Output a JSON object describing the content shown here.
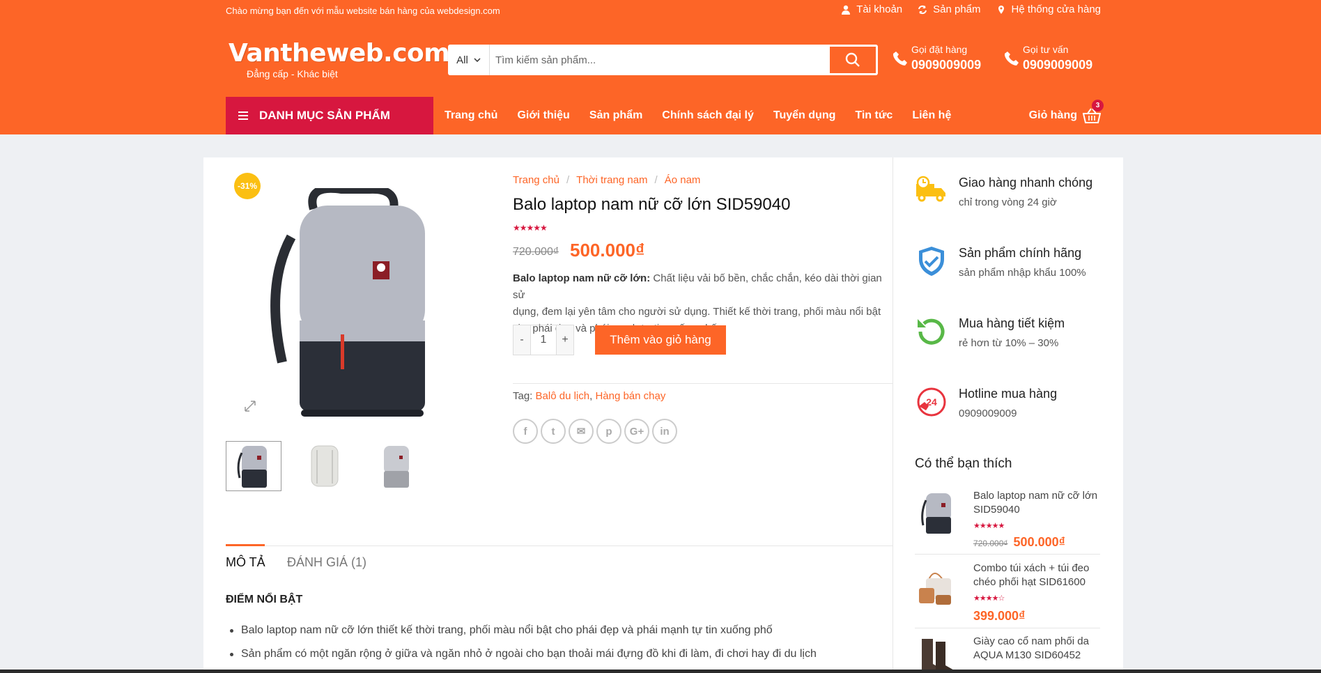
{
  "topbar": {
    "welcome": "Chào mừng bạn đến với mẫu website bán hàng của webdesign.com",
    "links": [
      "Tài khoản",
      "Sản phẩm",
      "Hệ thống cửa hàng"
    ]
  },
  "header": {
    "logo": "Vantheweb.com",
    "slogan": "Đẳng cấp - Khác biệt",
    "search_category": "All",
    "search_placeholder": "Tìm kiếm sản phẩm...",
    "hotline_order_label": "Gọi đặt hàng",
    "hotline_order_number": "0909009009",
    "hotline_advice_label": "Gọi tư vấn",
    "hotline_advice_number": "0909009009"
  },
  "nav": {
    "category_button": "DANH MỤC SẢN PHẨM",
    "links": [
      "Trang chủ",
      "Giới thiệu",
      "Sản phẩm",
      "Chính sách đại lý",
      "Tuyển dụng",
      "Tin tức",
      "Liên hệ"
    ],
    "cart_label": "Giỏ hàng",
    "cart_count": "3"
  },
  "product": {
    "sale_badge": "-31%",
    "breadcrumb": [
      "Trang chủ",
      "Thời trang nam",
      "Áo nam"
    ],
    "title": "Balo laptop nam nữ cỡ lớn SID59040",
    "rating_stars": "★★★★★",
    "old_price": "720.000₫",
    "new_price": "500.000₫",
    "desc_bold": "Balo laptop nam nữ cỡ lớn:",
    "desc_line1": " Chất liệu vải bố bền, chắc chắn, kéo dài thời gian sử",
    "desc_line2": "dụng, đem lại yên tâm cho người sử dụng. Thiết kế thời trang, phối màu nổi bật",
    "desc_line3": "cho phái đẹp và phái mạnh tự tin xuống phố",
    "qty_minus": "-",
    "qty_value": "1",
    "qty_plus": "+",
    "add_to_cart": "Thêm vào giỏ hàng",
    "tag_label": "Tag:",
    "tags": [
      "Balô du lịch",
      "Hàng bán chạy"
    ],
    "share_icons": [
      "f",
      "t",
      "✉",
      "p",
      "G+",
      "in"
    ]
  },
  "tabs": {
    "description": "MÔ TẢ",
    "reviews": "ĐÁNH GIÁ (1)"
  },
  "description": {
    "heading": "ĐIỂM NỔI BẬT",
    "bullets": [
      "Balo laptop nam nữ cỡ lớn thiết kế thời trang, phối màu nổi bật cho phái đẹp và phái mạnh tự tin xuống phố",
      "Sản phẩm có một ngăn rộng ở giữa và ngăn nhỏ ở ngoài cho bạn thoải mái đựng đồ khi đi làm, đi chơi hay đi du lịch"
    ]
  },
  "sidebar": {
    "features": [
      {
        "title": "Giao hàng nhanh chóng",
        "desc": "chỉ trong vòng 24 giờ",
        "icon": "truck-icon"
      },
      {
        "title": "Sản phẩm chính hãng",
        "desc": "sản phẩm nhập khẩu 100%",
        "icon": "shield-check-icon"
      },
      {
        "title": "Mua hàng tiết kiệm",
        "desc": "rẻ hơn từ 10% – 30%",
        "icon": "refresh-icon"
      },
      {
        "title": "Hotline mua hàng",
        "desc": "0909009009",
        "icon": "phone-24-icon"
      }
    ],
    "may_like_title": "Có thể bạn thích",
    "related": [
      {
        "name": "Balo laptop nam nữ cỡ lớn SID59040",
        "stars": "★★★★★",
        "old_price": "720.000₫",
        "price": "500.000₫"
      },
      {
        "name": "Combo túi xách + túi đeo chéo phối hạt SID61600",
        "stars": "★★★★☆",
        "old_price": "",
        "price": "399.000₫"
      },
      {
        "name": "Giày cao cổ nam phối da AQUA M130 SID60452",
        "stars": "★★★★★",
        "old_price": "",
        "price": ""
      }
    ]
  },
  "colors": {
    "brand_orange": "#fd6527",
    "brand_red": "#d7173f",
    "sale_yellow": "#fbbf12"
  }
}
